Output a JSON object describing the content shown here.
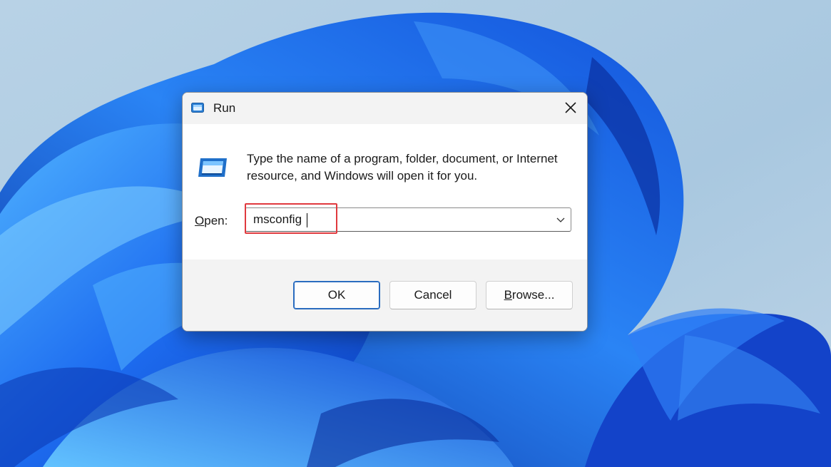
{
  "dialog": {
    "title": "Run",
    "description": "Type the name of a program, folder, document, or Internet resource, and Windows will open it for you.",
    "open_label_accel": "O",
    "open_label_rest": "pen:",
    "input_value": "msconfig",
    "buttons": {
      "ok": "OK",
      "cancel": "Cancel",
      "browse_accel": "B",
      "browse_rest": "rowse..."
    }
  },
  "icons": {
    "title": "run-app-icon",
    "close": "close-icon",
    "body": "run-app-icon",
    "dropdown": "chevron-down-icon"
  },
  "colors": {
    "highlight": "#e0393e",
    "accent": "#2a6cbf",
    "wallpaper_blue": "#1a5fe6"
  }
}
